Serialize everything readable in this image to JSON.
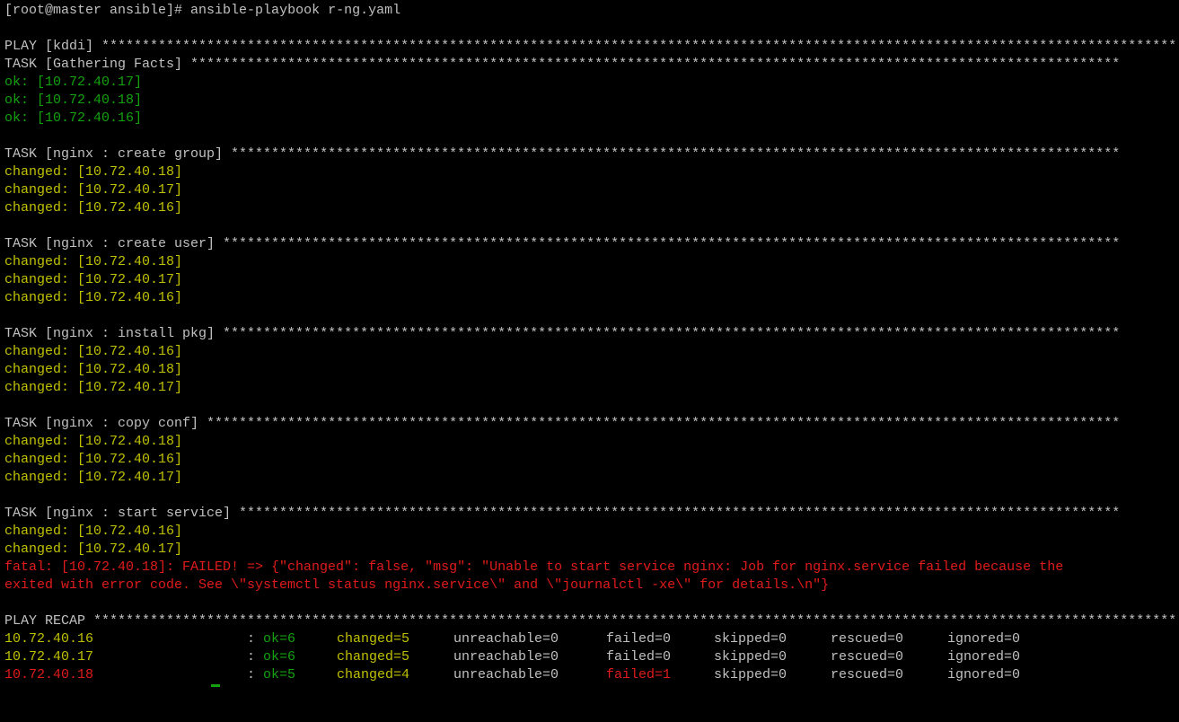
{
  "prompt_line": {
    "prompt": "[root@master ansible]# ",
    "command": "ansible-playbook r-ng.yaml"
  },
  "play": {
    "header": "PLAY [kddi] ",
    "stars": "*************************************************************************************************************************************"
  },
  "tasks": [
    {
      "header": "TASK [Gathering Facts] ",
      "stars": "*******************************************************************************************************************",
      "results": [
        {
          "status": "ok",
          "text": "ok: [10.72.40.17]"
        },
        {
          "status": "ok",
          "text": "ok: [10.72.40.18]"
        },
        {
          "status": "ok",
          "text": "ok: [10.72.40.16]"
        }
      ]
    },
    {
      "header": "TASK [nginx : create group] ",
      "stars": "**************************************************************************************************************",
      "results": [
        {
          "status": "changed",
          "text": "changed: [10.72.40.18]"
        },
        {
          "status": "changed",
          "text": "changed: [10.72.40.17]"
        },
        {
          "status": "changed",
          "text": "changed: [10.72.40.16]"
        }
      ]
    },
    {
      "header": "TASK [nginx : create user] ",
      "stars": "***************************************************************************************************************",
      "results": [
        {
          "status": "changed",
          "text": "changed: [10.72.40.18]"
        },
        {
          "status": "changed",
          "text": "changed: [10.72.40.17]"
        },
        {
          "status": "changed",
          "text": "changed: [10.72.40.16]"
        }
      ]
    },
    {
      "header": "TASK [nginx : install pkg] ",
      "stars": "***************************************************************************************************************",
      "results": [
        {
          "status": "changed",
          "text": "changed: [10.72.40.16]"
        },
        {
          "status": "changed",
          "text": "changed: [10.72.40.18]"
        },
        {
          "status": "changed",
          "text": "changed: [10.72.40.17]"
        }
      ]
    },
    {
      "header": "TASK [nginx : copy conf] ",
      "stars": "*****************************************************************************************************************",
      "results": [
        {
          "status": "changed",
          "text": "changed: [10.72.40.18]"
        },
        {
          "status": "changed",
          "text": "changed: [10.72.40.16]"
        },
        {
          "status": "changed",
          "text": "changed: [10.72.40.17]"
        }
      ]
    },
    {
      "header": "TASK [nginx : start service] ",
      "stars": "*************************************************************************************************************",
      "results": [
        {
          "status": "changed",
          "text": "changed: [10.72.40.16]"
        },
        {
          "status": "changed",
          "text": "changed: [10.72.40.17]"
        },
        {
          "status": "fatal",
          "text": "fatal: [10.72.40.18]: FAILED! => {\"changed\": false, \"msg\": \"Unable to start service nginx: Job for nginx.service failed because the"
        },
        {
          "status": "fatal",
          "text": "exited with error code. See \\\"systemctl status nginx.service\\\" and \\\"journalctl -xe\\\" for details.\\n\"}"
        }
      ]
    }
  ],
  "recap": {
    "header": "PLAY RECAP ",
    "stars": "**************************************************************************************************************************************",
    "hosts": [
      {
        "host": "10.72.40.16",
        "failed_host": false,
        "colon": ": ",
        "ok": "ok=6",
        "changed": "changed=5",
        "unreachable": "unreachable=0",
        "failed": "failed=0",
        "failed_nonzero": false,
        "skipped": "skipped=0",
        "rescued": "rescued=0",
        "ignored": "ignored=0"
      },
      {
        "host": "10.72.40.17",
        "failed_host": false,
        "colon": ": ",
        "ok": "ok=6",
        "changed": "changed=5",
        "unreachable": "unreachable=0",
        "failed": "failed=0",
        "failed_nonzero": false,
        "skipped": "skipped=0",
        "rescued": "rescued=0",
        "ignored": "ignored=0"
      },
      {
        "host": "10.72.40.18",
        "failed_host": true,
        "colon": ": ",
        "ok": "ok=5",
        "changed": "changed=4",
        "unreachable": "unreachable=0",
        "failed": "failed=1",
        "failed_nonzero": true,
        "skipped": "skipped=0",
        "rescued": "rescued=0",
        "ignored": "ignored=0"
      }
    ]
  },
  "colors": {
    "background": "#000000",
    "default_text": "#c0c0c0",
    "ok": "#13a10e",
    "changed": "#c0c000",
    "fatal": "#e01b1b"
  }
}
